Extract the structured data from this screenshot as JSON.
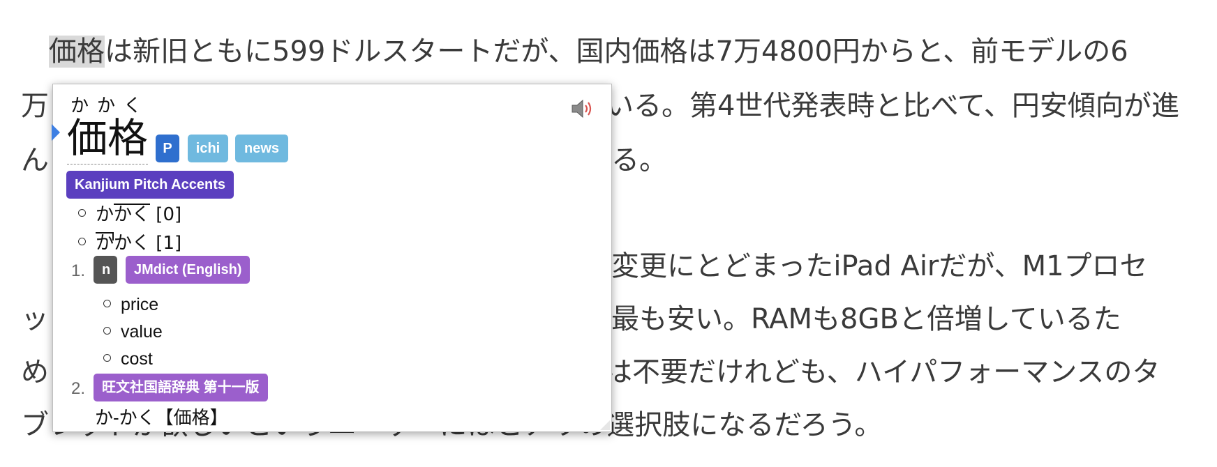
{
  "article": {
    "line1_prefix": "　",
    "line1_highlight": "価格",
    "line1_rest": "は新旧ともに599ドルスタートだが、国内価格は7万4800円からと、前モデルの6",
    "line2_left": "万",
    "line2_right": "いる。第4世代発表時と比べて、円安傾向が進",
    "line3_left": "ん",
    "line3_right": "る。",
    "line4_right": "変更にとどまったiPad Airだが、M1プロセ",
    "line5_left": "ッ",
    "line5_right": "最も安い。RAMも8GBと倍増しているた",
    "line6_left": "め",
    "line6_right": "は不要だけれども、ハイパフォーマンスのタ",
    "line7": "ブレットが欲しいというユーザーにはとアリの選択肢になるだろう。"
  },
  "popup": {
    "furigana": "かかく",
    "headword": "価格",
    "tags": [
      "P",
      "ichi",
      "news"
    ],
    "speaker_icon": "speaker-icon",
    "pitch_section_label": "Kanjium Pitch Accents",
    "pitch_accents": [
      {
        "mora_first": "か",
        "mora_rest": "かく",
        "accent": "[0]"
      },
      {
        "mora_first": "か",
        "mora_rest": "かく",
        "accent": "[1]"
      }
    ],
    "senses": [
      {
        "number": "1.",
        "pos": "n",
        "dictionary": "JMdict (English)",
        "glosses": [
          "price",
          "value",
          "cost"
        ]
      },
      {
        "number": "2.",
        "dictionary": "旺文社国語辞典 第十一版",
        "entry": "か-かく【価格】"
      }
    ],
    "colors": {
      "tag_p": "#2f6fce",
      "tag_common": "#6fb9df",
      "kanjium": "#5b3fbf",
      "pos": "#555555",
      "dict": "#9b5fcc",
      "pointer": "#3d7fe3"
    }
  }
}
